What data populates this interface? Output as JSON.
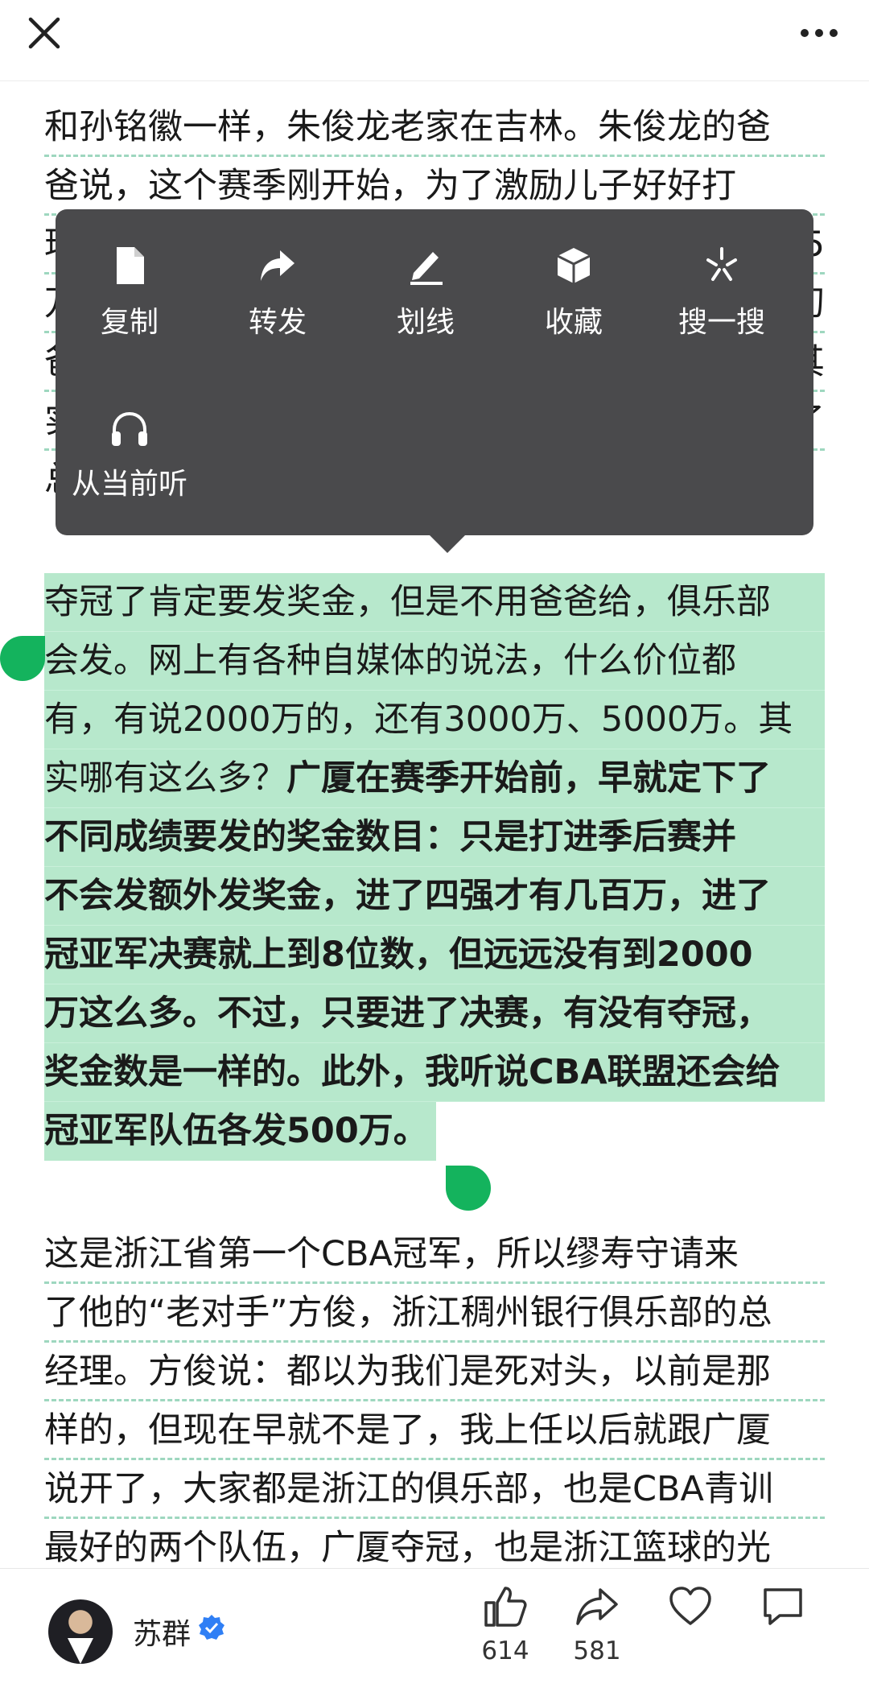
{
  "article": {
    "p1_lines": [
      "和孙铭徽一样，朱俊龙老家在吉林。朱俊龙的爸",
      "爸说，这个赛季刚开始，为了激励儿子好好打",
      "球",
      "万",
      "爸",
      "实",
      "总"
    ],
    "selected_lines": [
      {
        "n": "夺冠了肯定要发奖金，但是不用爸爸给，俱乐部"
      },
      {
        "n": "会发。网上有各种自媒体的说法，什么价位都"
      },
      {
        "n": "有，有说2000万的，还有3000万、5000万。其"
      },
      {
        "n": "实哪有这么多？",
        "b": "广厦在赛季开始前，早就定下了"
      },
      {
        "b": "不同成绩要发的奖金数目：只是打进季后赛并"
      },
      {
        "b": "不会发额外发奖金，进了四强才有几百万，进了"
      },
      {
        "b": "冠亚军决赛就上到8位数，但远远没有到2000"
      },
      {
        "b": "万这么多。不过，只要进了决赛，有没有夺冠，"
      },
      {
        "b": "奖金数是一样的。此外，我听说CBA联盟还会给"
      },
      {
        "b": "冠亚军队伍各发500万。"
      }
    ],
    "p3_lines": [
      "这是浙江省第一个CBA冠军，所以缪寿守请来",
      "了他的“老对手”方俊，浙江稠州银行俱乐部的总",
      "经理。方俊说：都以为我们是死对头，以前是那",
      "样的，但现在早就不是了，我上任以后就跟广厦",
      "说开了，大家都是浙江的俱乐部，也是CBA青训",
      "最好的两个队伍，广厦夺冠，也是浙江篮球的光"
    ],
    "right_fragments": [
      "5",
      "叨",
      "其",
      "了"
    ]
  },
  "popup": {
    "items": [
      {
        "label": "复制",
        "icon": "document-icon"
      },
      {
        "label": "转发",
        "icon": "forward-arrow-icon"
      },
      {
        "label": "划线",
        "icon": "pen-underline-icon"
      },
      {
        "label": "收藏",
        "icon": "cube-icon"
      },
      {
        "label": "搜一搜",
        "icon": "search-sparkle-icon"
      },
      {
        "label": "从当前听",
        "icon": "headphones-icon"
      }
    ]
  },
  "footer": {
    "author": "苏群",
    "likes": "614",
    "shares": "581"
  },
  "colors": {
    "highlight": "#b7e8cc",
    "handle": "#14b35d",
    "popup_bg": "#4a4a4c",
    "dashed_underline": "#9ed7bf"
  }
}
